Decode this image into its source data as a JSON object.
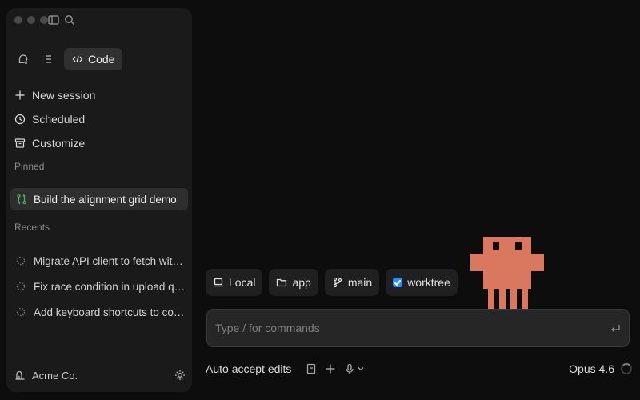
{
  "sidebar": {
    "mode_button": "Code",
    "menu": [
      {
        "label": "New session",
        "icon": "plus-icon"
      },
      {
        "label": "Scheduled",
        "icon": "clock-icon"
      },
      {
        "label": "Customize",
        "icon": "archive-icon"
      }
    ],
    "pinned_label": "Pinned",
    "pinned_item": {
      "label": "Build the alignment grid demo",
      "icon": "git-compare-icon",
      "icon_color": "#4caf50"
    },
    "recents_label": "Recents",
    "recents": [
      {
        "label": "Migrate API client to fetch with retries"
      },
      {
        "label": "Fix race condition in upload queue"
      },
      {
        "label": "Add keyboard shortcuts to command palette"
      }
    ],
    "org_name": "Acme Co."
  },
  "chips": {
    "location": "Local",
    "folder": "app",
    "branch": "main",
    "worktree": "worktree",
    "worktree_checked": true
  },
  "input": {
    "placeholder": "Type / for commands"
  },
  "bottom": {
    "mode_label": "Auto accept edits",
    "model_label": "Opus 4.6"
  },
  "colors": {
    "accent_checkbox": "#2f8af5",
    "mascot": "#d9785f",
    "background": "#0d0d0d",
    "sidebar": "#1a1a1a"
  }
}
